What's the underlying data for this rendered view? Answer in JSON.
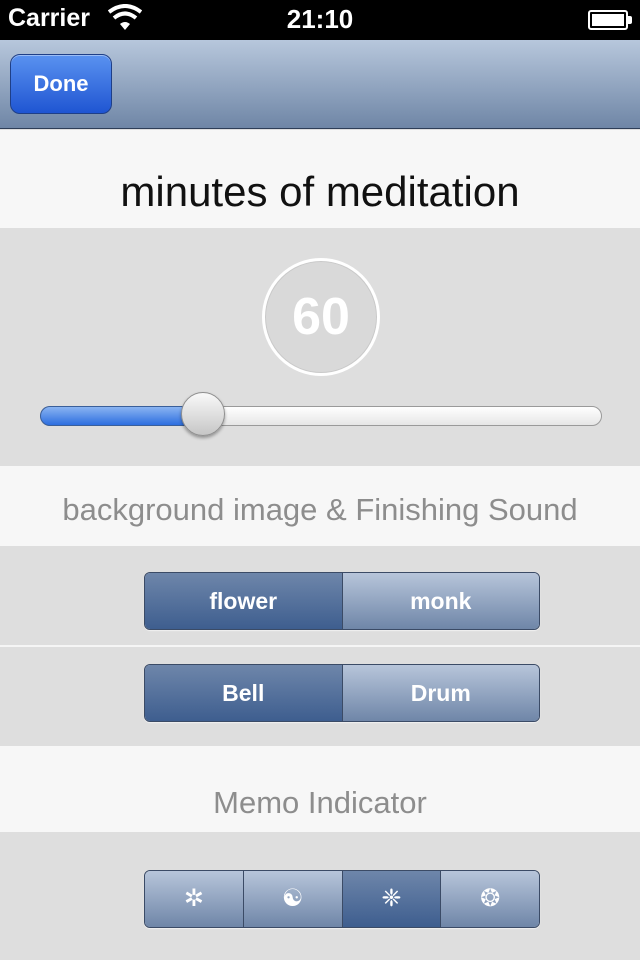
{
  "status_bar": {
    "carrier": "Carrier",
    "time": "21:10"
  },
  "navbar": {
    "done_label": "Done"
  },
  "meditation": {
    "title": "minutes of meditation",
    "minutes": "60",
    "slider_fraction": 0.29
  },
  "background_section": {
    "title": "background image & Finishing Sound",
    "image_options": [
      "flower",
      "monk"
    ],
    "image_selected": "flower",
    "sound_options": [
      "Bell",
      "Drum"
    ],
    "sound_selected": "Bell"
  },
  "memo_section": {
    "title": "Memo Indicator",
    "icons": [
      {
        "glyph": "✲",
        "name": "asterisk-flower-icon"
      },
      {
        "glyph": "☯",
        "name": "yin-yang-icon"
      },
      {
        "glyph": "❈",
        "name": "sparkle-icon"
      },
      {
        "glyph": "❂",
        "name": "sun-wheel-icon"
      }
    ],
    "selected_index": 2
  }
}
